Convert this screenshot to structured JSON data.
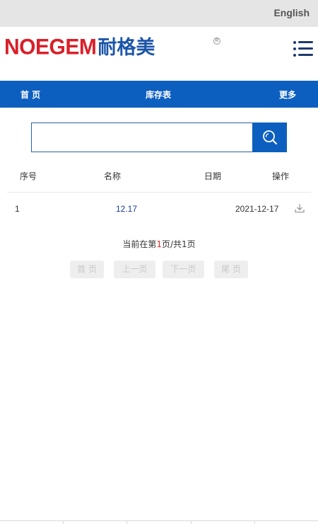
{
  "topbar": {
    "language": "English"
  },
  "brand": {
    "name_en": "NOEGEM",
    "name_cn": "耐格美",
    "reg_mark": "R"
  },
  "nav": {
    "home": "首 页",
    "inventory": "库存表",
    "more": "更多"
  },
  "search": {
    "value": "",
    "placeholder": ""
  },
  "table": {
    "headers": {
      "index": "序号",
      "name": "名称",
      "date": "日期",
      "action": "操作"
    },
    "rows": [
      {
        "index": "1",
        "name": "12.17",
        "date": "2021-12-17"
      }
    ]
  },
  "pagination": {
    "prefix": "当前在第",
    "current": "1",
    "middle": "页/共",
    "total": "1",
    "suffix": "页",
    "first": "首 页",
    "prev": "上一页",
    "next": "下一页",
    "last": "尾 页"
  },
  "colors": {
    "accent": "#0d5fbf",
    "brand_red": "#d8202a",
    "brand_blue": "#1c55a8",
    "link": "#1a3c9a"
  }
}
